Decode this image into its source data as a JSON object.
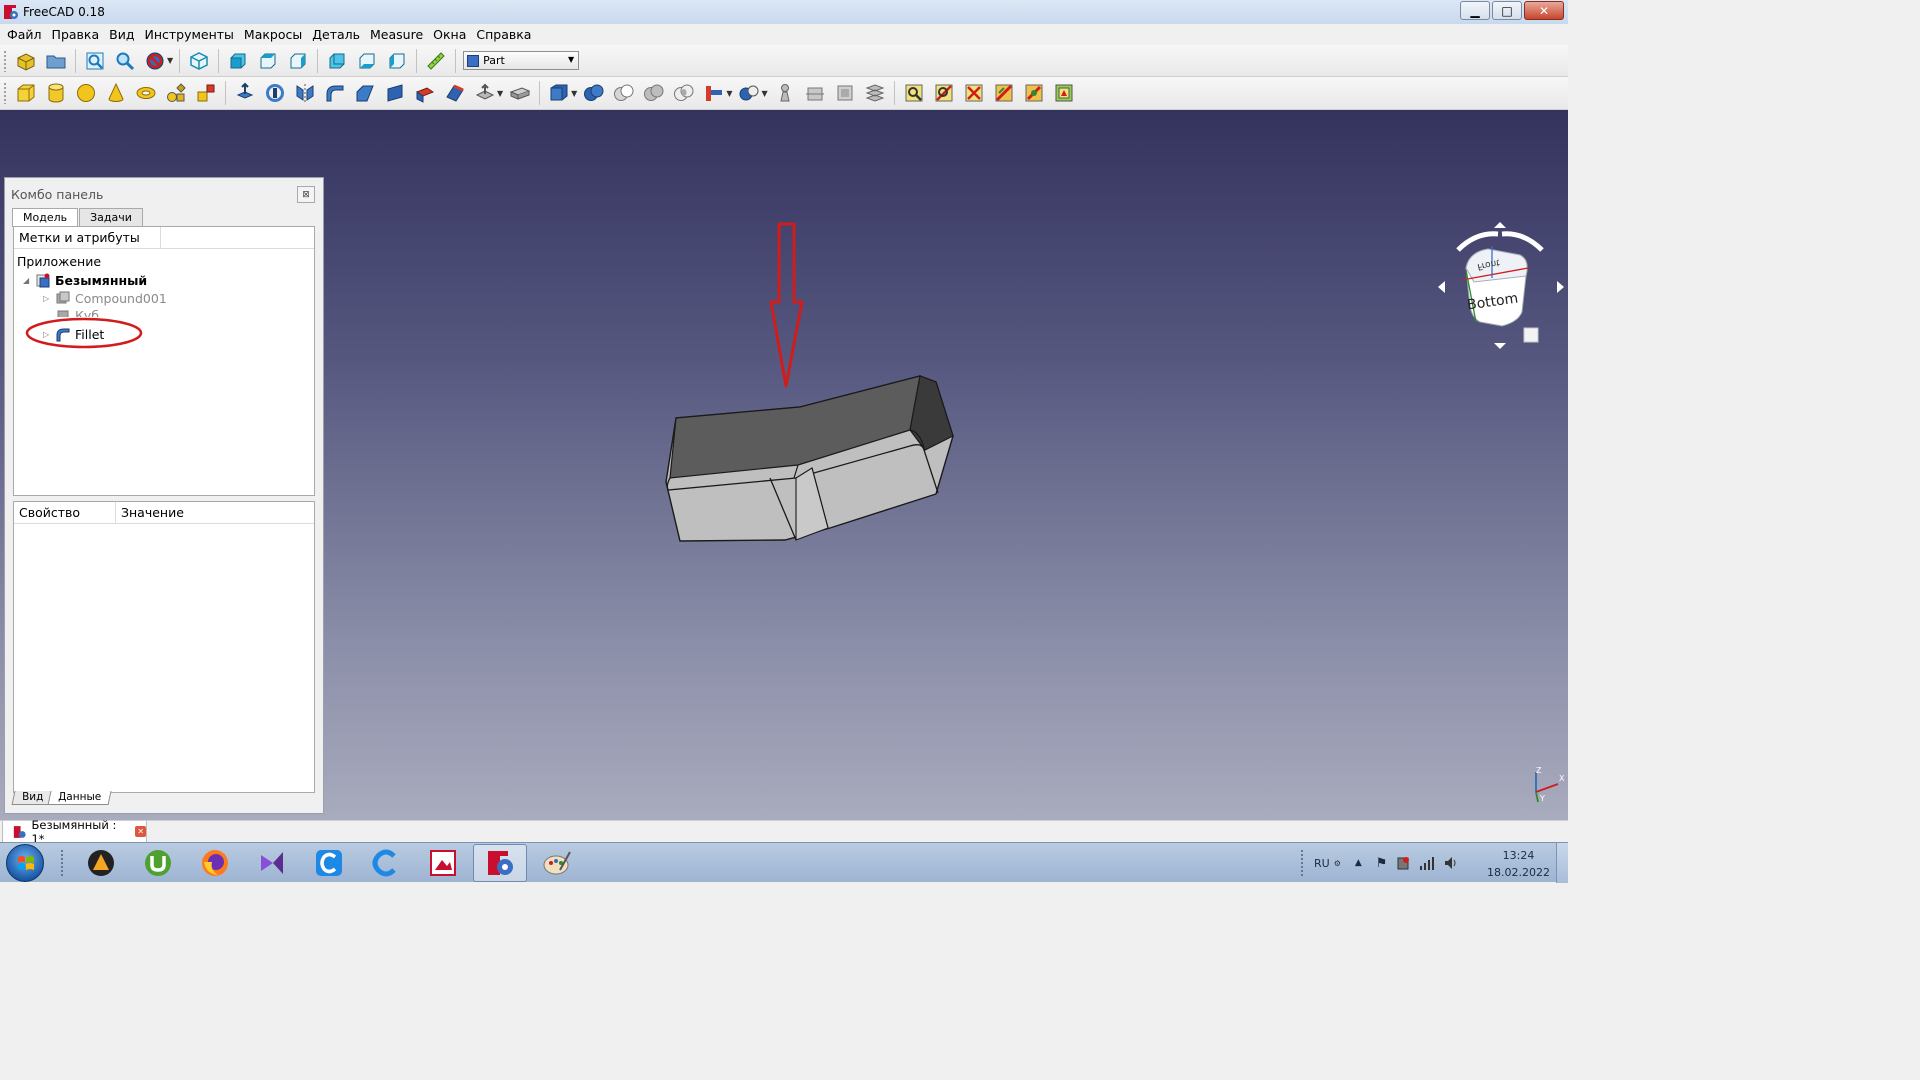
{
  "window": {
    "title": "FreeCAD 0.18",
    "btn_minimize": "▁",
    "btn_maximize": "□",
    "btn_close": "✕"
  },
  "menu": [
    "Файл",
    "Правка",
    "Вид",
    "Инструменты",
    "Макросы",
    "Деталь",
    "Measure",
    "Окна",
    "Справка"
  ],
  "toolbar": {
    "workbench": "Part"
  },
  "combo": {
    "title": "Комбо панель",
    "close": "⊠",
    "tabs": [
      "Модель",
      "Задачи"
    ],
    "tree_header": [
      "Метки и атрибуты",
      ""
    ],
    "tree": {
      "root": "Приложение",
      "document": "Безымянный",
      "items": [
        "Compound001",
        "Куб",
        "Fillet"
      ]
    },
    "prop_header": [
      "Свойство",
      "Значение"
    ],
    "prop_tabs": [
      "Вид",
      "Данные"
    ]
  },
  "navcube": {
    "face_top": "Front",
    "face_main": "Bottom"
  },
  "axis": {
    "x": "X",
    "y": "Y",
    "z": "Z"
  },
  "doc_tab": {
    "label": "Безымянный : 1*",
    "close": "✕"
  },
  "taskbar": {
    "lang": "RU",
    "time": "13:24",
    "date": "18.02.2022"
  },
  "colors": {
    "view_top": "#33335e",
    "view_bottom": "#a9abbe",
    "annotation": "#d01c1c"
  }
}
